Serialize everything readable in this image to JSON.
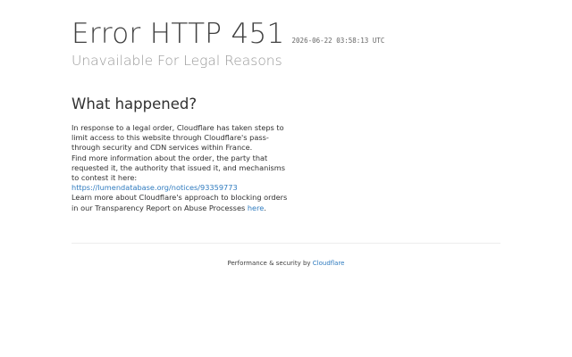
{
  "header": {
    "error_title": "Error HTTP 451",
    "timestamp": "2026-06-22 03:58:13 UTC",
    "subtitle": "Unavailable For Legal Reasons"
  },
  "main": {
    "heading": "What happened?",
    "paragraph1": "In response to a legal order, Cloudflare has taken steps to limit access to this website through Cloudflare's pass-through security and CDN services within France.",
    "paragraph2_prefix": "Find more information about the order, the party that requested it, the authority that issued it, and mechanisms to contest it here: ",
    "notice_link": "https://lumendatabase.org/notices/93359773",
    "paragraph3_prefix": "Learn more about Cloudflare's approach to blocking orders in our Transparency Report on Abuse Processes ",
    "here_link": "here",
    "paragraph3_suffix": "."
  },
  "footer": {
    "prefix": "Performance & security by ",
    "brand_link": "Cloudflare"
  },
  "colors": {
    "link": "#2f7bbf",
    "title": "#404040",
    "subtitle": "#999999"
  }
}
